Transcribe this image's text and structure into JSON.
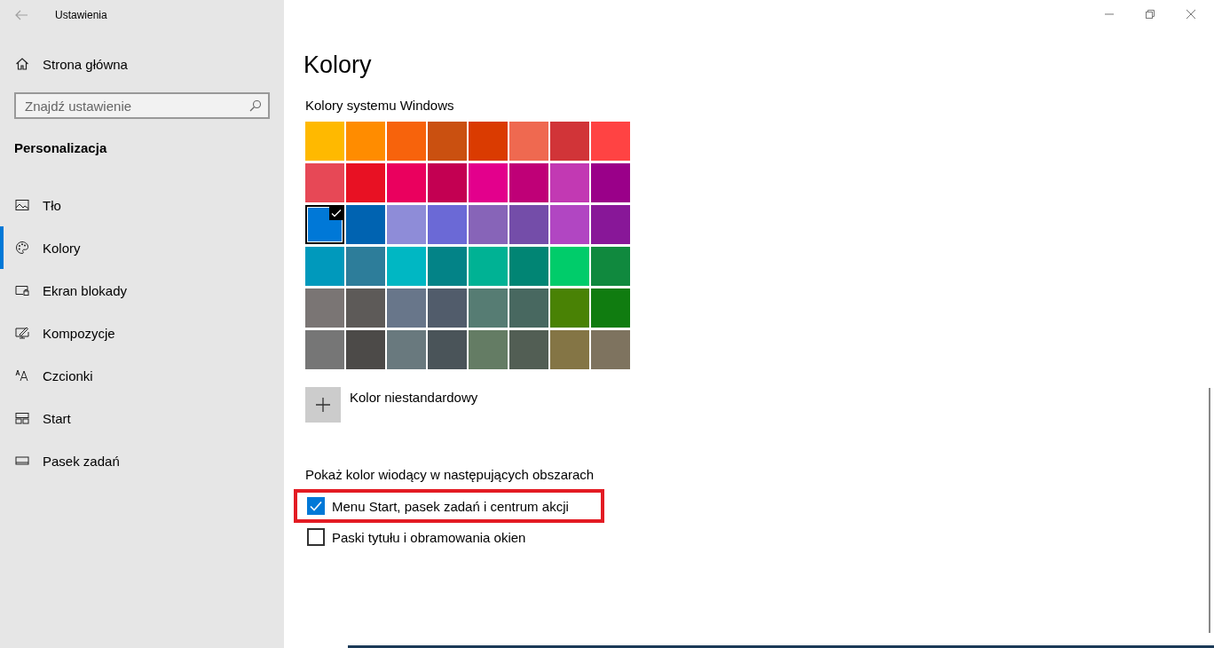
{
  "window": {
    "title": "Ustawienia"
  },
  "sidebar": {
    "home": "Strona główna",
    "search": {
      "placeholder": "Znajdź ustawienie"
    },
    "section": "Personalizacja",
    "items": [
      {
        "label": "Tło",
        "kind": "picture",
        "selected": false
      },
      {
        "label": "Kolory",
        "kind": "palette",
        "selected": true
      },
      {
        "label": "Ekran blokady",
        "kind": "lock",
        "selected": false
      },
      {
        "label": "Kompozycje",
        "kind": "brush",
        "selected": false
      },
      {
        "label": "Czcionki",
        "kind": "font",
        "selected": false
      },
      {
        "label": "Start",
        "kind": "tiles",
        "selected": false
      },
      {
        "label": "Pasek zadań",
        "kind": "taskbar",
        "selected": false
      }
    ]
  },
  "page": {
    "title": "Kolory",
    "palette_label": "Kolory systemu Windows",
    "swatches": [
      {
        "color": "#ffb900",
        "selected": false
      },
      {
        "color": "#ff8c00",
        "selected": false
      },
      {
        "color": "#f7630c",
        "selected": false
      },
      {
        "color": "#ca5010",
        "selected": false
      },
      {
        "color": "#da3b01",
        "selected": false
      },
      {
        "color": "#ef6950",
        "selected": false
      },
      {
        "color": "#d13438",
        "selected": false
      },
      {
        "color": "#ff4343",
        "selected": false
      },
      {
        "color": "#e74856",
        "selected": false
      },
      {
        "color": "#e81123",
        "selected": false
      },
      {
        "color": "#ea005e",
        "selected": false
      },
      {
        "color": "#c30052",
        "selected": false
      },
      {
        "color": "#e3008c",
        "selected": false
      },
      {
        "color": "#bf0077",
        "selected": false
      },
      {
        "color": "#c239b3",
        "selected": false
      },
      {
        "color": "#9a0089",
        "selected": false
      },
      {
        "color": "#0078d7",
        "selected": true
      },
      {
        "color": "#0063b1",
        "selected": false
      },
      {
        "color": "#8e8cd8",
        "selected": false
      },
      {
        "color": "#6b69d6",
        "selected": false
      },
      {
        "color": "#8764b8",
        "selected": false
      },
      {
        "color": "#744da9",
        "selected": false
      },
      {
        "color": "#b146c2",
        "selected": false
      },
      {
        "color": "#881798",
        "selected": false
      },
      {
        "color": "#0099bc",
        "selected": false
      },
      {
        "color": "#2d7d9a",
        "selected": false
      },
      {
        "color": "#00b7c3",
        "selected": false
      },
      {
        "color": "#038387",
        "selected": false
      },
      {
        "color": "#00b294",
        "selected": false
      },
      {
        "color": "#018574",
        "selected": false
      },
      {
        "color": "#00cc6a",
        "selected": false
      },
      {
        "color": "#10893e",
        "selected": false
      },
      {
        "color": "#7a7574",
        "selected": false
      },
      {
        "color": "#5d5a58",
        "selected": false
      },
      {
        "color": "#68768a",
        "selected": false
      },
      {
        "color": "#515c6b",
        "selected": false
      },
      {
        "color": "#567c73",
        "selected": false
      },
      {
        "color": "#486860",
        "selected": false
      },
      {
        "color": "#498205",
        "selected": false
      },
      {
        "color": "#107c10",
        "selected": false
      },
      {
        "color": "#767676",
        "selected": false
      },
      {
        "color": "#4c4a48",
        "selected": false
      },
      {
        "color": "#69797e",
        "selected": false
      },
      {
        "color": "#4a5459",
        "selected": false
      },
      {
        "color": "#647c64",
        "selected": false
      },
      {
        "color": "#525e54",
        "selected": false
      },
      {
        "color": "#847545",
        "selected": false
      },
      {
        "color": "#7e735f",
        "selected": false
      }
    ],
    "custom_color": "Kolor niestandardowy",
    "accent_label": "Pokaż kolor wiodący w następujących obszarach",
    "options": [
      {
        "label": "Menu Start, pasek zadań i centrum akcji",
        "checked": true,
        "highlighted": true
      },
      {
        "label": "Paski tytułu i obramowania okien",
        "checked": false,
        "highlighted": false
      }
    ]
  }
}
